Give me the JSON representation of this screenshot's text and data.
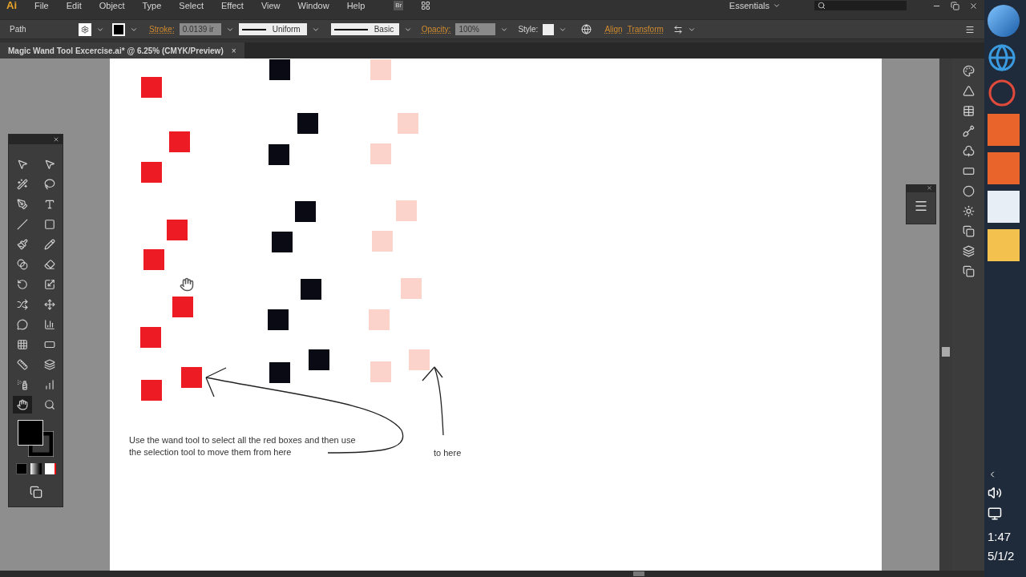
{
  "app_logo": "Ai",
  "menu": [
    "File",
    "Edit",
    "Object",
    "Type",
    "Select",
    "Effect",
    "View",
    "Window",
    "Help"
  ],
  "bridge_button": "Br",
  "workspace": "Essentials",
  "control_bar": {
    "selection": "Path",
    "stroke_link": "Stroke:",
    "stroke_weight": "0.0139 ir",
    "profile": "Uniform",
    "brush": "Basic",
    "opacity_link": "Opacity:",
    "opacity": "100%",
    "style_label": "Style:",
    "align_link": "Align",
    "transform_link": "Transform"
  },
  "document_tab": {
    "title": "Magic Wand Tool Excercise.ai* @ 6.25% (CMYK/Preview)",
    "close": "×"
  },
  "tools": [
    {
      "selected": false
    },
    {
      "selected": false
    },
    {
      "selected": false
    },
    {
      "selected": false
    },
    {
      "selected": false
    },
    {
      "selected": false
    },
    {
      "selected": false
    },
    {
      "selected": false
    },
    {
      "selected": false
    },
    {
      "selected": false
    },
    {
      "selected": false
    },
    {
      "selected": false
    },
    {
      "selected": false
    },
    {
      "selected": false
    },
    {
      "selected": false
    },
    {
      "selected": false
    },
    {
      "selected": false
    },
    {
      "selected": false
    },
    {
      "selected": false
    },
    {
      "selected": false
    },
    {
      "selected": false
    },
    {
      "selected": false
    },
    {
      "selected": false
    },
    {
      "selected": false
    },
    {
      "selected": true
    },
    {
      "selected": false
    }
  ],
  "squares": [
    {
      "color": "#ed1c24"
    },
    {
      "color": "#ed1c24"
    },
    {
      "color": "#ed1c24"
    },
    {
      "color": "#ed1c24"
    },
    {
      "color": "#ed1c24"
    },
    {
      "color": "#ed1c24"
    },
    {
      "color": "#ed1c24"
    },
    {
      "color": "#ed1c24"
    },
    {
      "color": "#ed1c24"
    },
    {
      "color": "#0a0a14"
    },
    {
      "color": "#0a0a14"
    },
    {
      "color": "#0a0a14"
    },
    {
      "color": "#0a0a14"
    },
    {
      "color": "#0a0a14"
    },
    {
      "color": "#0a0a14"
    },
    {
      "color": "#0a0a14"
    },
    {
      "color": "#0a0a14"
    },
    {
      "color": "#0a0a14"
    },
    {
      "color": "#fbd3cb"
    },
    {
      "color": "#fbd3cb"
    },
    {
      "color": "#fbd3cb"
    },
    {
      "color": "#fbd3cb"
    },
    {
      "color": "#fbd3cb"
    },
    {
      "color": "#fbd3cb"
    },
    {
      "color": "#fbd3cb"
    },
    {
      "color": "#fbd3cb"
    },
    {
      "color": "#fbd3cb"
    }
  ],
  "instruction": [
    "Use the wand tool to select  all the red boxes and then use",
    "the selection tool to move them from here"
  ],
  "target_label": "to here",
  "clock": {
    "time": "1:47",
    "date": "5/1/2"
  }
}
